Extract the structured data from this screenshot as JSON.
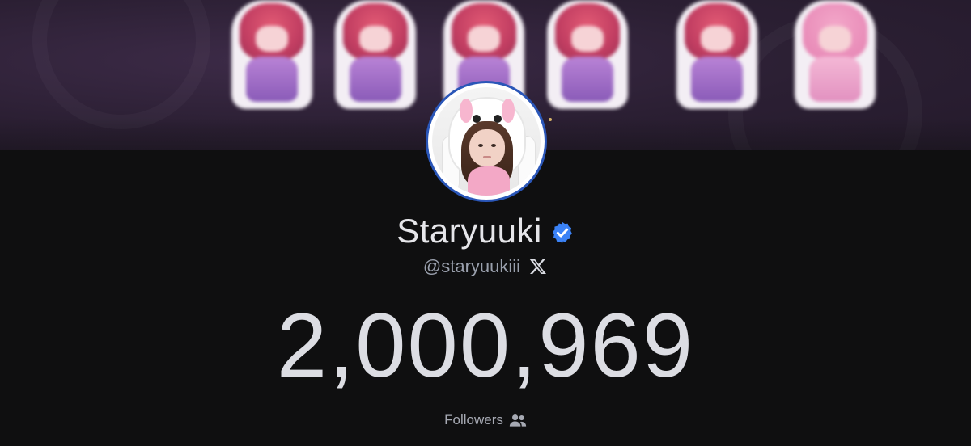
{
  "profile": {
    "display_name": "Staryuuki",
    "handle": "@staryuukiii",
    "verified": true,
    "platform_icon": "x-logo-icon",
    "verified_icon": "verified-badge-icon",
    "avatar": "avatar"
  },
  "stats": {
    "followers_count": "2,000,969",
    "followers_label": "Followers",
    "label_icon": "users-icon"
  },
  "colors": {
    "background": "#0f0f10",
    "banner": "#2b1f33",
    "avatar_ring": "#2a56b8",
    "verified_blue": "#3b82f6",
    "text_primary": "#e6e6ea",
    "text_secondary": "#9aa0ad"
  }
}
